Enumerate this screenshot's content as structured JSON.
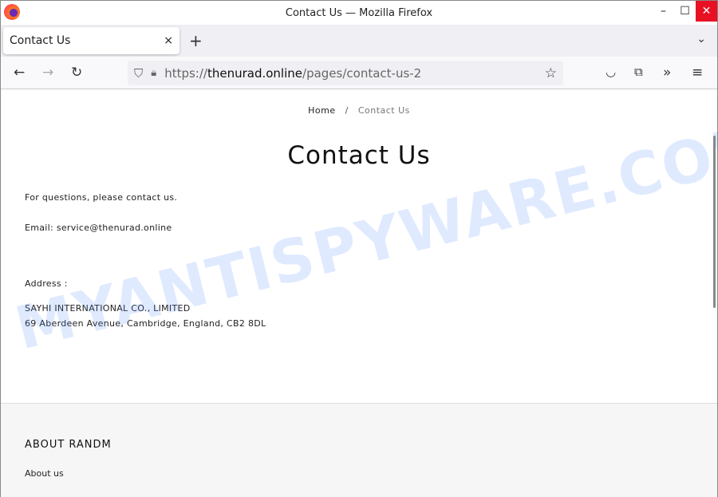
{
  "window": {
    "title": "Contact Us — Mozilla Firefox"
  },
  "tab": {
    "label": "Contact Us",
    "close": "×",
    "new": "+"
  },
  "url": {
    "scheme": "https://",
    "domain": "thenurad.online",
    "path": "/pages/contact-us-2"
  },
  "breadcrumb": {
    "home": "Home",
    "sep": "/",
    "current": "Contact Us"
  },
  "page": {
    "title": "Contact Us",
    "intro": "For questions, please contact us.",
    "email": "Email: service@thenurad.online",
    "address_label": "Address :",
    "company": "SAYHI INTERNATIONAL CO., LIMITED",
    "address": "69 Aberdeen Avenue, Cambridge, England, CB2 8DL"
  },
  "footer": {
    "heading": "ABOUT RANDM",
    "link": "About us"
  },
  "watermark": "MYANTISPYWARE.COM"
}
